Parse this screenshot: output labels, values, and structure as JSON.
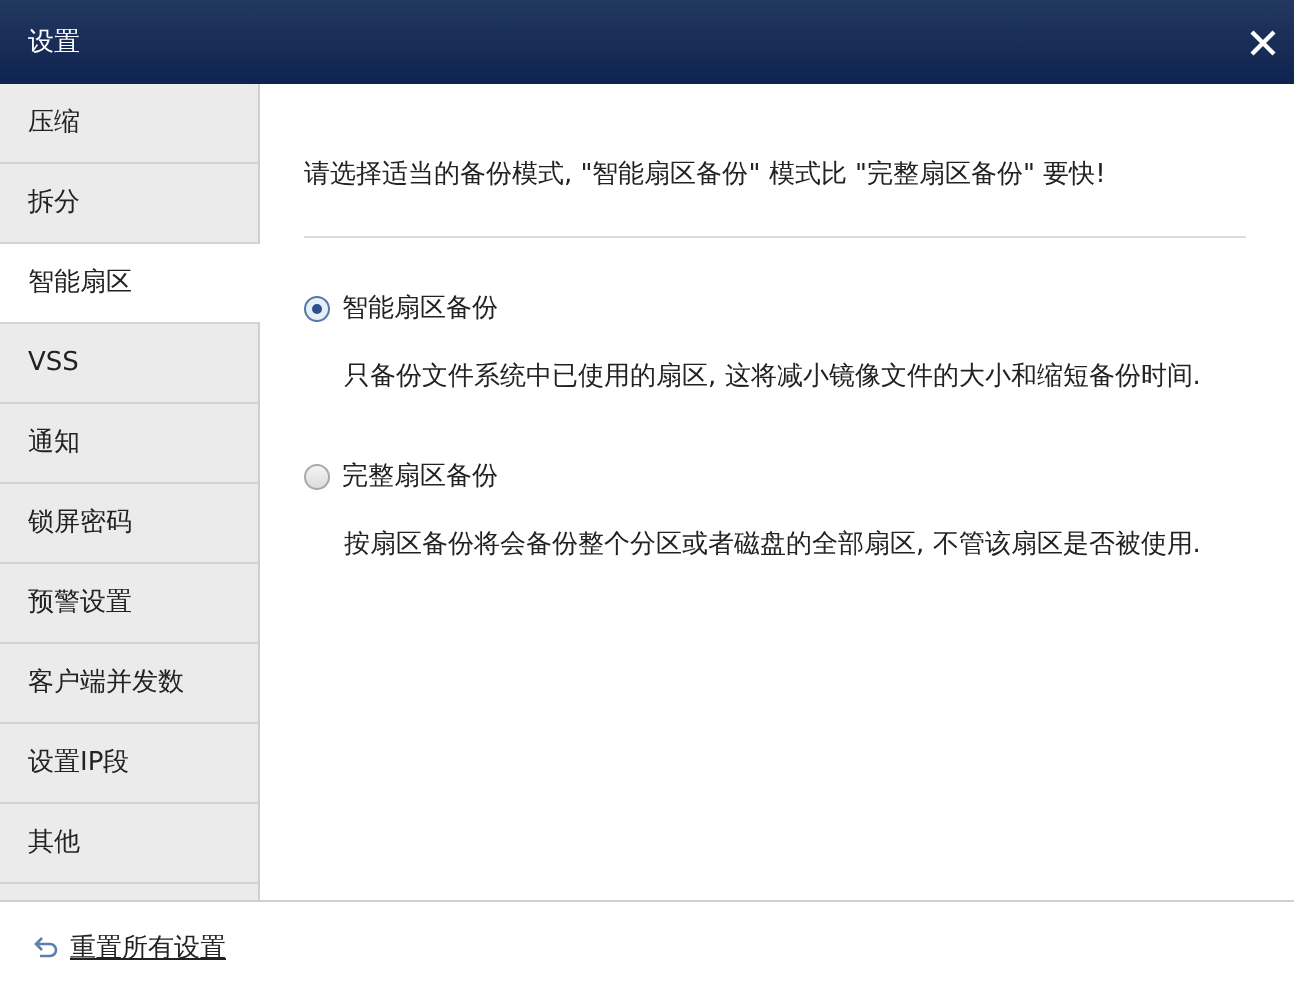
{
  "window": {
    "title": "设置"
  },
  "sidebar": {
    "items": [
      {
        "label": "压缩",
        "selected": false
      },
      {
        "label": "拆分",
        "selected": false
      },
      {
        "label": "智能扇区",
        "selected": true
      },
      {
        "label": "VSS",
        "selected": false
      },
      {
        "label": "通知",
        "selected": false
      },
      {
        "label": "锁屏密码",
        "selected": false
      },
      {
        "label": "预警设置",
        "selected": false
      },
      {
        "label": "客户端并发数",
        "selected": false
      },
      {
        "label": "设置IP段",
        "selected": false
      },
      {
        "label": "其他",
        "selected": false
      }
    ]
  },
  "intro": "请选择适当的备份模式, \"智能扇区备份\" 模式比 \"完整扇区备份\" 要快!",
  "options": [
    {
      "label": "智能扇区备份",
      "selected": true,
      "description": "只备份文件系统中已使用的扇区, 这将减小镜像文件的大小和缩短备份时间."
    },
    {
      "label": "完整扇区备份",
      "selected": false,
      "description": "按扇区备份将会备份整个分区或者磁盘的全部扇区, 不管该扇区是否被使用."
    }
  ],
  "footer": {
    "reset_link": "重置所有设置"
  }
}
